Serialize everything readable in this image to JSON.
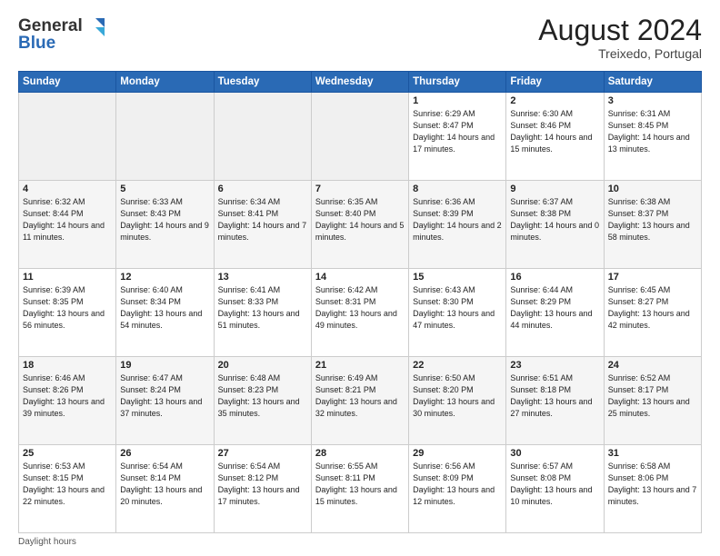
{
  "header": {
    "logo_line1": "General",
    "logo_line2": "Blue",
    "month_year": "August 2024",
    "location": "Treixedo, Portugal"
  },
  "days_of_week": [
    "Sunday",
    "Monday",
    "Tuesday",
    "Wednesday",
    "Thursday",
    "Friday",
    "Saturday"
  ],
  "footer": "Daylight hours",
  "weeks": [
    [
      {
        "day": "",
        "empty": true
      },
      {
        "day": "",
        "empty": true
      },
      {
        "day": "",
        "empty": true
      },
      {
        "day": "",
        "empty": true
      },
      {
        "day": "1",
        "sunrise": "6:29 AM",
        "sunset": "8:47 PM",
        "daylight": "14 hours and 17 minutes."
      },
      {
        "day": "2",
        "sunrise": "6:30 AM",
        "sunset": "8:46 PM",
        "daylight": "14 hours and 15 minutes."
      },
      {
        "day": "3",
        "sunrise": "6:31 AM",
        "sunset": "8:45 PM",
        "daylight": "14 hours and 13 minutes."
      }
    ],
    [
      {
        "day": "4",
        "sunrise": "6:32 AM",
        "sunset": "8:44 PM",
        "daylight": "14 hours and 11 minutes."
      },
      {
        "day": "5",
        "sunrise": "6:33 AM",
        "sunset": "8:43 PM",
        "daylight": "14 hours and 9 minutes."
      },
      {
        "day": "6",
        "sunrise": "6:34 AM",
        "sunset": "8:41 PM",
        "daylight": "14 hours and 7 minutes."
      },
      {
        "day": "7",
        "sunrise": "6:35 AM",
        "sunset": "8:40 PM",
        "daylight": "14 hours and 5 minutes."
      },
      {
        "day": "8",
        "sunrise": "6:36 AM",
        "sunset": "8:39 PM",
        "daylight": "14 hours and 2 minutes."
      },
      {
        "day": "9",
        "sunrise": "6:37 AM",
        "sunset": "8:38 PM",
        "daylight": "14 hours and 0 minutes."
      },
      {
        "day": "10",
        "sunrise": "6:38 AM",
        "sunset": "8:37 PM",
        "daylight": "13 hours and 58 minutes."
      }
    ],
    [
      {
        "day": "11",
        "sunrise": "6:39 AM",
        "sunset": "8:35 PM",
        "daylight": "13 hours and 56 minutes."
      },
      {
        "day": "12",
        "sunrise": "6:40 AM",
        "sunset": "8:34 PM",
        "daylight": "13 hours and 54 minutes."
      },
      {
        "day": "13",
        "sunrise": "6:41 AM",
        "sunset": "8:33 PM",
        "daylight": "13 hours and 51 minutes."
      },
      {
        "day": "14",
        "sunrise": "6:42 AM",
        "sunset": "8:31 PM",
        "daylight": "13 hours and 49 minutes."
      },
      {
        "day": "15",
        "sunrise": "6:43 AM",
        "sunset": "8:30 PM",
        "daylight": "13 hours and 47 minutes."
      },
      {
        "day": "16",
        "sunrise": "6:44 AM",
        "sunset": "8:29 PM",
        "daylight": "13 hours and 44 minutes."
      },
      {
        "day": "17",
        "sunrise": "6:45 AM",
        "sunset": "8:27 PM",
        "daylight": "13 hours and 42 minutes."
      }
    ],
    [
      {
        "day": "18",
        "sunrise": "6:46 AM",
        "sunset": "8:26 PM",
        "daylight": "13 hours and 39 minutes."
      },
      {
        "day": "19",
        "sunrise": "6:47 AM",
        "sunset": "8:24 PM",
        "daylight": "13 hours and 37 minutes."
      },
      {
        "day": "20",
        "sunrise": "6:48 AM",
        "sunset": "8:23 PM",
        "daylight": "13 hours and 35 minutes."
      },
      {
        "day": "21",
        "sunrise": "6:49 AM",
        "sunset": "8:21 PM",
        "daylight": "13 hours and 32 minutes."
      },
      {
        "day": "22",
        "sunrise": "6:50 AM",
        "sunset": "8:20 PM",
        "daylight": "13 hours and 30 minutes."
      },
      {
        "day": "23",
        "sunrise": "6:51 AM",
        "sunset": "8:18 PM",
        "daylight": "13 hours and 27 minutes."
      },
      {
        "day": "24",
        "sunrise": "6:52 AM",
        "sunset": "8:17 PM",
        "daylight": "13 hours and 25 minutes."
      }
    ],
    [
      {
        "day": "25",
        "sunrise": "6:53 AM",
        "sunset": "8:15 PM",
        "daylight": "13 hours and 22 minutes."
      },
      {
        "day": "26",
        "sunrise": "6:54 AM",
        "sunset": "8:14 PM",
        "daylight": "13 hours and 20 minutes."
      },
      {
        "day": "27",
        "sunrise": "6:54 AM",
        "sunset": "8:12 PM",
        "daylight": "13 hours and 17 minutes."
      },
      {
        "day": "28",
        "sunrise": "6:55 AM",
        "sunset": "8:11 PM",
        "daylight": "13 hours and 15 minutes."
      },
      {
        "day": "29",
        "sunrise": "6:56 AM",
        "sunset": "8:09 PM",
        "daylight": "13 hours and 12 minutes."
      },
      {
        "day": "30",
        "sunrise": "6:57 AM",
        "sunset": "8:08 PM",
        "daylight": "13 hours and 10 minutes."
      },
      {
        "day": "31",
        "sunrise": "6:58 AM",
        "sunset": "8:06 PM",
        "daylight": "13 hours and 7 minutes."
      }
    ]
  ]
}
